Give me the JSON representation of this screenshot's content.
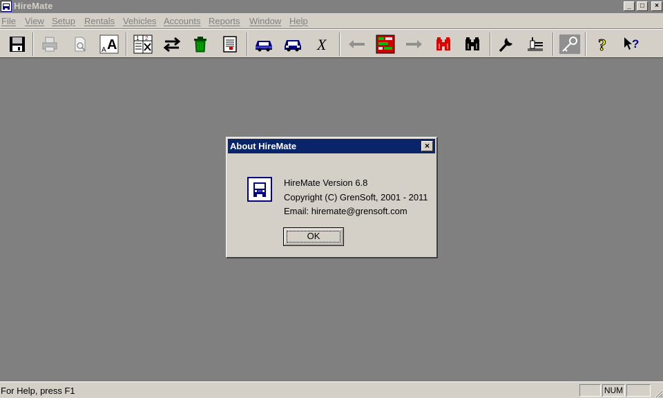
{
  "window": {
    "title": "HireMate",
    "minimize_label": "_",
    "maximize_label": "□",
    "close_label": "×"
  },
  "menu": [
    {
      "label": "File"
    },
    {
      "label": "View"
    },
    {
      "label": "Setup"
    },
    {
      "label": "Rentals"
    },
    {
      "label": "Vehicles"
    },
    {
      "label": "Accounts"
    },
    {
      "label": "Reports"
    },
    {
      "label": "Window"
    },
    {
      "label": "Help"
    }
  ],
  "toolbar": {
    "buttons": [
      {
        "icon": "save-icon"
      },
      {
        "icon": "print-icon"
      },
      {
        "icon": "print-preview-icon"
      },
      {
        "icon": "font-icon"
      },
      {
        "icon": "spreadsheet-icon"
      },
      {
        "icon": "swap-icon"
      },
      {
        "icon": "delete-icon"
      },
      {
        "icon": "document-icon"
      },
      {
        "icon": "car-out-icon"
      },
      {
        "icon": "car-in-icon"
      },
      {
        "icon": "cancel-icon"
      },
      {
        "icon": "back-arrow-icon"
      },
      {
        "icon": "chart-icon"
      },
      {
        "icon": "forward-arrow-icon"
      },
      {
        "icon": "find-red-icon"
      },
      {
        "icon": "binoculars-icon"
      },
      {
        "icon": "wrench-icon"
      },
      {
        "icon": "tools-icon"
      },
      {
        "icon": "key-icon"
      },
      {
        "icon": "help-icon"
      },
      {
        "icon": "context-help-icon"
      }
    ],
    "colors": {
      "car": "#000080",
      "delete": "#008000",
      "find": "#e00000"
    }
  },
  "dialog": {
    "title": "About HireMate",
    "close_label": "×",
    "line1": "HireMate Version 6.8",
    "line2": "Copyright (C) GrenSoft, 2001 - 2011",
    "line3": "Email: hiremate@grensoft.com",
    "ok_label": "OK",
    "title_color": "#0a246a"
  },
  "status": {
    "help_text": "For Help, press F1",
    "num_label": "NUM"
  }
}
